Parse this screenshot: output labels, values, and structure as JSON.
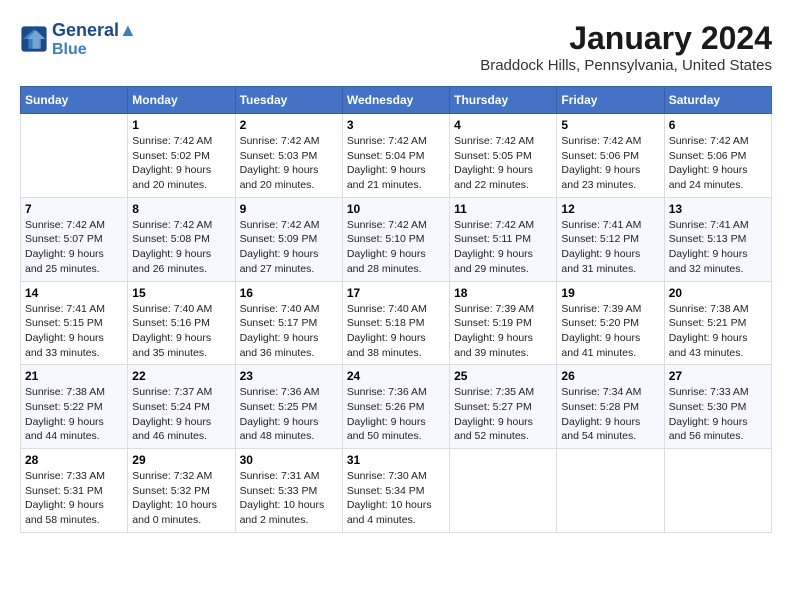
{
  "header": {
    "logo_line1": "General",
    "logo_line2": "Blue",
    "month": "January 2024",
    "location": "Braddock Hills, Pennsylvania, United States"
  },
  "weekdays": [
    "Sunday",
    "Monday",
    "Tuesday",
    "Wednesday",
    "Thursday",
    "Friday",
    "Saturday"
  ],
  "weeks": [
    [
      {
        "day": "",
        "text": ""
      },
      {
        "day": "1",
        "text": "Sunrise: 7:42 AM\nSunset: 5:02 PM\nDaylight: 9 hours\nand 20 minutes."
      },
      {
        "day": "2",
        "text": "Sunrise: 7:42 AM\nSunset: 5:03 PM\nDaylight: 9 hours\nand 20 minutes."
      },
      {
        "day": "3",
        "text": "Sunrise: 7:42 AM\nSunset: 5:04 PM\nDaylight: 9 hours\nand 21 minutes."
      },
      {
        "day": "4",
        "text": "Sunrise: 7:42 AM\nSunset: 5:05 PM\nDaylight: 9 hours\nand 22 minutes."
      },
      {
        "day": "5",
        "text": "Sunrise: 7:42 AM\nSunset: 5:06 PM\nDaylight: 9 hours\nand 23 minutes."
      },
      {
        "day": "6",
        "text": "Sunrise: 7:42 AM\nSunset: 5:06 PM\nDaylight: 9 hours\nand 24 minutes."
      }
    ],
    [
      {
        "day": "7",
        "text": "Sunrise: 7:42 AM\nSunset: 5:07 PM\nDaylight: 9 hours\nand 25 minutes."
      },
      {
        "day": "8",
        "text": "Sunrise: 7:42 AM\nSunset: 5:08 PM\nDaylight: 9 hours\nand 26 minutes."
      },
      {
        "day": "9",
        "text": "Sunrise: 7:42 AM\nSunset: 5:09 PM\nDaylight: 9 hours\nand 27 minutes."
      },
      {
        "day": "10",
        "text": "Sunrise: 7:42 AM\nSunset: 5:10 PM\nDaylight: 9 hours\nand 28 minutes."
      },
      {
        "day": "11",
        "text": "Sunrise: 7:42 AM\nSunset: 5:11 PM\nDaylight: 9 hours\nand 29 minutes."
      },
      {
        "day": "12",
        "text": "Sunrise: 7:41 AM\nSunset: 5:12 PM\nDaylight: 9 hours\nand 31 minutes."
      },
      {
        "day": "13",
        "text": "Sunrise: 7:41 AM\nSunset: 5:13 PM\nDaylight: 9 hours\nand 32 minutes."
      }
    ],
    [
      {
        "day": "14",
        "text": "Sunrise: 7:41 AM\nSunset: 5:15 PM\nDaylight: 9 hours\nand 33 minutes."
      },
      {
        "day": "15",
        "text": "Sunrise: 7:40 AM\nSunset: 5:16 PM\nDaylight: 9 hours\nand 35 minutes."
      },
      {
        "day": "16",
        "text": "Sunrise: 7:40 AM\nSunset: 5:17 PM\nDaylight: 9 hours\nand 36 minutes."
      },
      {
        "day": "17",
        "text": "Sunrise: 7:40 AM\nSunset: 5:18 PM\nDaylight: 9 hours\nand 38 minutes."
      },
      {
        "day": "18",
        "text": "Sunrise: 7:39 AM\nSunset: 5:19 PM\nDaylight: 9 hours\nand 39 minutes."
      },
      {
        "day": "19",
        "text": "Sunrise: 7:39 AM\nSunset: 5:20 PM\nDaylight: 9 hours\nand 41 minutes."
      },
      {
        "day": "20",
        "text": "Sunrise: 7:38 AM\nSunset: 5:21 PM\nDaylight: 9 hours\nand 43 minutes."
      }
    ],
    [
      {
        "day": "21",
        "text": "Sunrise: 7:38 AM\nSunset: 5:22 PM\nDaylight: 9 hours\nand 44 minutes."
      },
      {
        "day": "22",
        "text": "Sunrise: 7:37 AM\nSunset: 5:24 PM\nDaylight: 9 hours\nand 46 minutes."
      },
      {
        "day": "23",
        "text": "Sunrise: 7:36 AM\nSunset: 5:25 PM\nDaylight: 9 hours\nand 48 minutes."
      },
      {
        "day": "24",
        "text": "Sunrise: 7:36 AM\nSunset: 5:26 PM\nDaylight: 9 hours\nand 50 minutes."
      },
      {
        "day": "25",
        "text": "Sunrise: 7:35 AM\nSunset: 5:27 PM\nDaylight: 9 hours\nand 52 minutes."
      },
      {
        "day": "26",
        "text": "Sunrise: 7:34 AM\nSunset: 5:28 PM\nDaylight: 9 hours\nand 54 minutes."
      },
      {
        "day": "27",
        "text": "Sunrise: 7:33 AM\nSunset: 5:30 PM\nDaylight: 9 hours\nand 56 minutes."
      }
    ],
    [
      {
        "day": "28",
        "text": "Sunrise: 7:33 AM\nSunset: 5:31 PM\nDaylight: 9 hours\nand 58 minutes."
      },
      {
        "day": "29",
        "text": "Sunrise: 7:32 AM\nSunset: 5:32 PM\nDaylight: 10 hours\nand 0 minutes."
      },
      {
        "day": "30",
        "text": "Sunrise: 7:31 AM\nSunset: 5:33 PM\nDaylight: 10 hours\nand 2 minutes."
      },
      {
        "day": "31",
        "text": "Sunrise: 7:30 AM\nSunset: 5:34 PM\nDaylight: 10 hours\nand 4 minutes."
      },
      {
        "day": "",
        "text": ""
      },
      {
        "day": "",
        "text": ""
      },
      {
        "day": "",
        "text": ""
      }
    ]
  ]
}
